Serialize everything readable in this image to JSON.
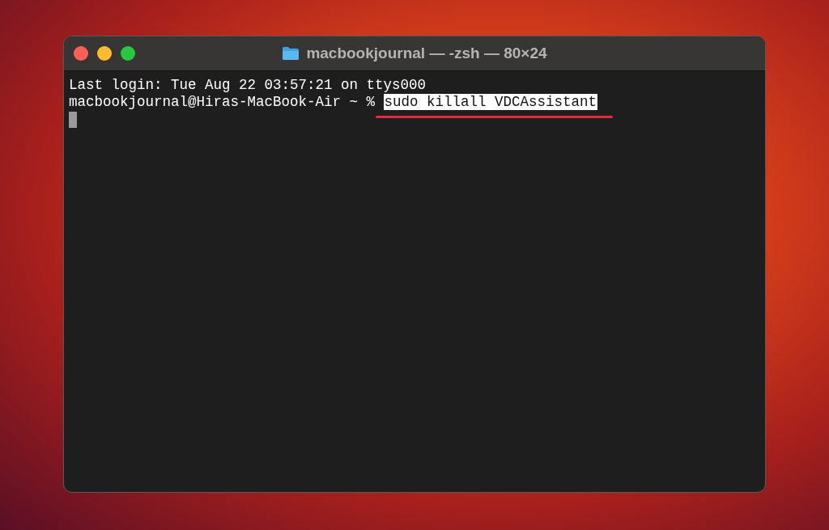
{
  "window": {
    "title": "macbookjournal — -zsh — 80×24"
  },
  "lines": [
    {
      "kind": "output",
      "text": "Last login: Tue Aug 22 03:57:21 on ttys000"
    },
    {
      "kind": "prompt",
      "prompt": "macbookjournal@Hiras-MacBook-Air ~ %",
      "command": "sudo killall VDCAssistant",
      "highlighted": true,
      "underlined": true
    },
    {
      "kind": "cursor"
    }
  ]
}
